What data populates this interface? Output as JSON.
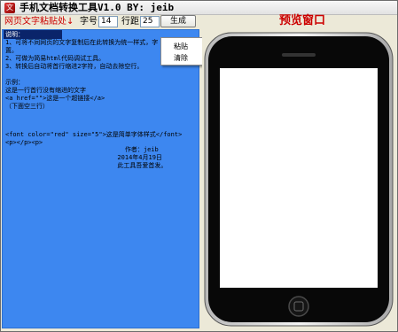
{
  "window": {
    "title": "手机文档转换工具V1.0 BY: jeib"
  },
  "toolbar": {
    "paste_label": "网页文字粘贴处↓",
    "font_size_label": "字号:",
    "font_size_value": "14",
    "line_spacing_label": "行距:",
    "line_spacing_value": "25",
    "generate_label": "生成",
    "preview_label": "预览窗口"
  },
  "editor": {
    "lines": [
      "说明：",
      "1、可将不同网页的文字复制后在此转换为统一样式，字",
      "置。",
      "2、可做为简易html代码调试工具。",
      "3、转换后自动将首行缩进2字符，自动去除空行。",
      "",
      "示例：",
      "这是一行首行没有缩进的文字",
      "<a href=\"\">这是一个超链接</a>",
      "（下面空三行）",
      "",
      "",
      "",
      "<font color=\"red\" size=\"5\">这是简单字体样式</font>",
      "<p></p><p>",
      "",
      "                                作者：jeib",
      "                              2014年4月19日",
      "                              此工具吾爱首发。"
    ]
  },
  "context_menu": {
    "items": [
      "粘贴",
      "清除"
    ]
  },
  "colors": {
    "editor_bg": "#3d87f0",
    "accent_red": "#cc0000"
  },
  "icons": {
    "app": "app-icon",
    "phone": "phone-frame"
  }
}
